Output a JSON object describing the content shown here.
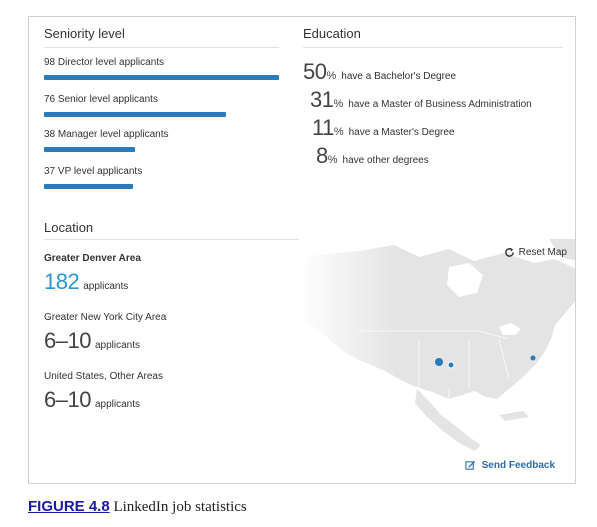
{
  "seniority": {
    "title": "Seniority level",
    "items": [
      {
        "label": "98 Director level applicants",
        "count": 98
      },
      {
        "label": "76 Senior level applicants",
        "count": 76
      },
      {
        "label": "38 Manager level applicants",
        "count": 38
      },
      {
        "label": "37 VP level applicants",
        "count": 37
      }
    ]
  },
  "education": {
    "title": "Education",
    "pct_symbol": "%",
    "items": [
      {
        "value": "50",
        "text": "have a Bachelor's Degree"
      },
      {
        "value": "31",
        "text": "have a Master of Business Administration"
      },
      {
        "value": "11",
        "text": "have a Master's Degree"
      },
      {
        "value": "8",
        "text": "have other degrees"
      }
    ]
  },
  "location": {
    "title": "Location",
    "items": [
      {
        "name": "Greater Denver Area",
        "count": "182",
        "unit": "applicants"
      },
      {
        "name": "Greater New York City Area",
        "count": "6–10",
        "unit": "applicants"
      },
      {
        "name": "United States, Other Areas",
        "count": "6–10",
        "unit": "applicants"
      }
    ],
    "reset_label": "Reset Map",
    "accent_color": "#2b96d0"
  },
  "feedback": {
    "label": "Send Feedback"
  },
  "caption": {
    "link": "FIGURE 4.8",
    "text": " LinkedIn job statistics"
  }
}
